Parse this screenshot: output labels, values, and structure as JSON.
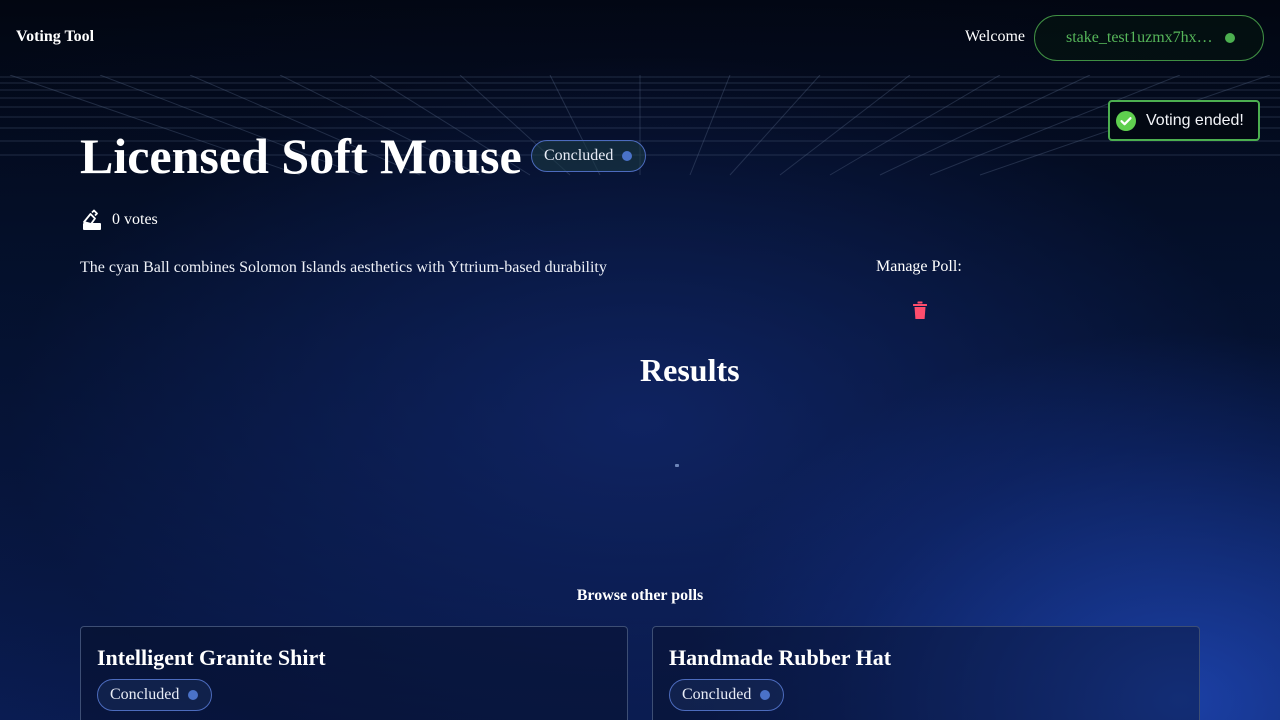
{
  "header": {
    "brand": "Voting Tool",
    "welcome": "Welcome",
    "wallet_address": "stake_test1uzmx7hx…",
    "wallet_status_color": "#4caf50"
  },
  "toast": {
    "message": "Voting ended!",
    "icon": "check-circle-icon",
    "color": "#4caf50"
  },
  "poll": {
    "title": "Licensed Soft Mouse",
    "status": "Concluded",
    "votes_label": "0 votes",
    "description": "The cyan Ball combines Solomon Islands aesthetics with Yttrium-based durability",
    "manage_label": "Manage Poll:",
    "delete_icon": "trash-icon",
    "delete_color": "#ff4d6d"
  },
  "results": {
    "heading": "Results"
  },
  "browse": {
    "heading": "Browse other polls",
    "polls": [
      {
        "title": "Intelligent Granite Shirt",
        "status": "Concluded"
      },
      {
        "title": "Handmade Rubber Hat",
        "status": "Concluded"
      }
    ]
  }
}
